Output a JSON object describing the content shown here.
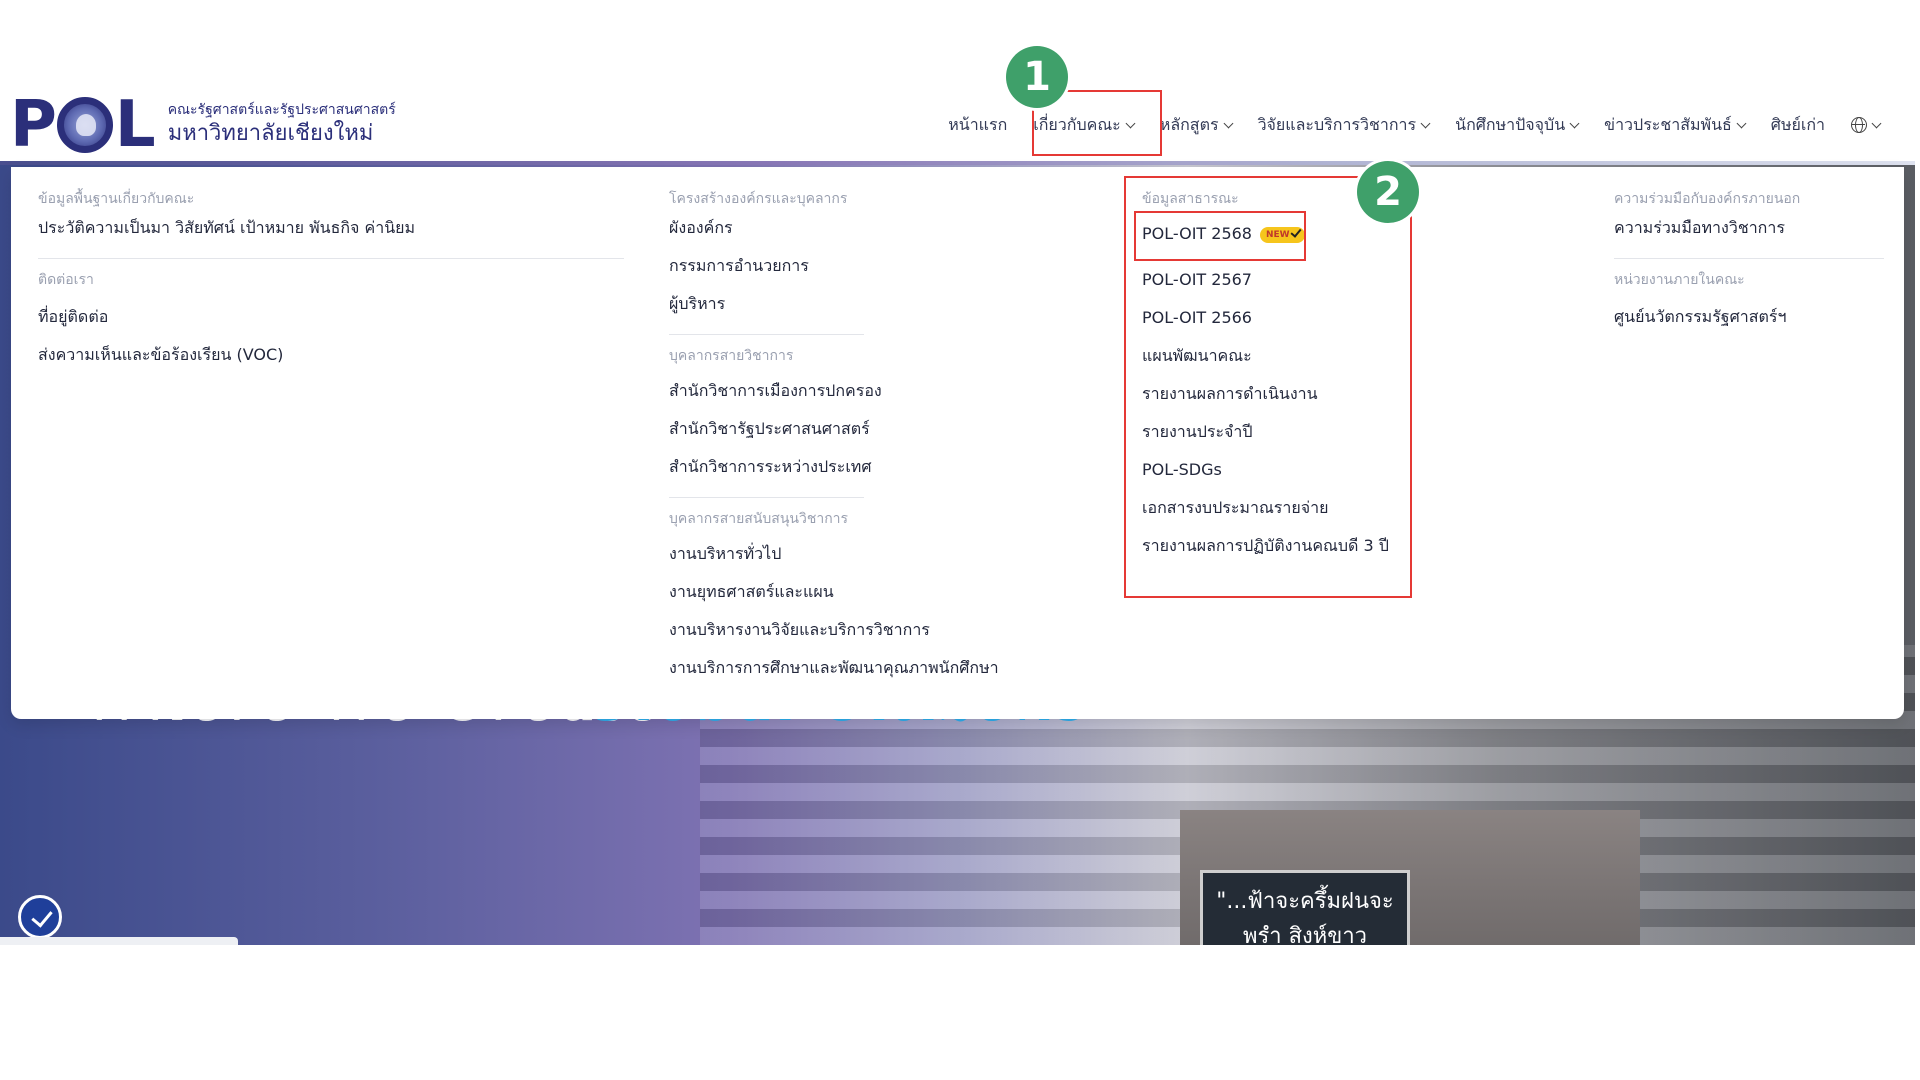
{
  "header": {
    "logo_text": "POL",
    "logo_subtitle_1": "คณะรัฐศาสตร์และรัฐประศาสนศาสตร์",
    "logo_subtitle_2": "มหาวิทยาลัยเชียงใหม่"
  },
  "nav": {
    "items": [
      {
        "label": "หน้าแรก",
        "has_chevron": false
      },
      {
        "label": "เกี่ยวกับคณะ",
        "has_chevron": true
      },
      {
        "label": "หลักสูตร",
        "has_chevron": true
      },
      {
        "label": "วิจัยและบริการวิชาการ",
        "has_chevron": true
      },
      {
        "label": "นักศึกษาปัจจุบัน",
        "has_chevron": true
      },
      {
        "label": "ข่าวประชาสัมพันธ์",
        "has_chevron": true
      },
      {
        "label": "ศิษย์เก่า",
        "has_chevron": false
      }
    ],
    "language_icon": "globe-icon"
  },
  "mega_menu": {
    "col1": {
      "head1": "ข้อมูลพื้นฐานเกี่ยวกับคณะ",
      "items1": [
        "ประวัติความเป็นมา วิสัยทัศน์ เป้าหมาย พันธกิจ ค่านิยม"
      ],
      "head2": "ติดต่อเรา",
      "items2": [
        "ที่อยู่ติดต่อ",
        "ส่งความเห็นและข้อร้องเรียน (VOC)"
      ]
    },
    "col2": {
      "head1": "โครงสร้างองค์กรและบุคลากร",
      "items1": [
        "ผังองค์กร",
        "กรรมการอำนวยการ",
        "ผู้บริหาร"
      ],
      "head2": "บุคลากรสายวิชาการ",
      "items2": [
        "สำนักวิชาการเมืองการปกครอง",
        "สำนักวิชารัฐประศาสนศาสตร์",
        "สำนักวิชาการระหว่างประเทศ"
      ],
      "head3": "บุคลากรสายสนับสนุนวิชาการ",
      "items3": [
        "งานบริหารทั่วไป",
        "งานยุทธศาสตร์และแผน",
        "งานบริหารงานวิจัยและบริการวิชาการ",
        "งานบริการการศึกษาและพัฒนาคุณภาพนักศึกษา"
      ]
    },
    "col3": {
      "head1": "ข้อมูลสาธารณะ",
      "items1": [
        "POL-OIT 2568",
        "POL-OIT 2567",
        "POL-OIT 2566",
        "แผนพัฒนาคณะ",
        "รายงานผลการดำเนินงาน",
        "รายงานประจำปี",
        "POL-SDGs",
        "เอกสารงบประมาณรายจ่าย",
        "รายงานผลการปฏิบัติงานคณบดี 3 ปี"
      ],
      "new_badge": "NEW"
    },
    "col4": {
      "head1": "ความร่วมมือกับองค์กรภายนอก",
      "items1": [
        "ความร่วมมือทางวิชาการ"
      ],
      "head2": "หน่วยงานภายในคณะ",
      "items2": [
        "ศูนย์นวัตกรรมรัฐศาสตร์ฯ"
      ]
    }
  },
  "annotations": {
    "callout_1": "1",
    "callout_2": "2",
    "box_color": "#e53935",
    "callout_color": "#3fa06a"
  },
  "hero": {
    "plaque_text": "\"...ฟ้าจะครึ้มฝนจะพรำ สิงห์ขาว"
  }
}
